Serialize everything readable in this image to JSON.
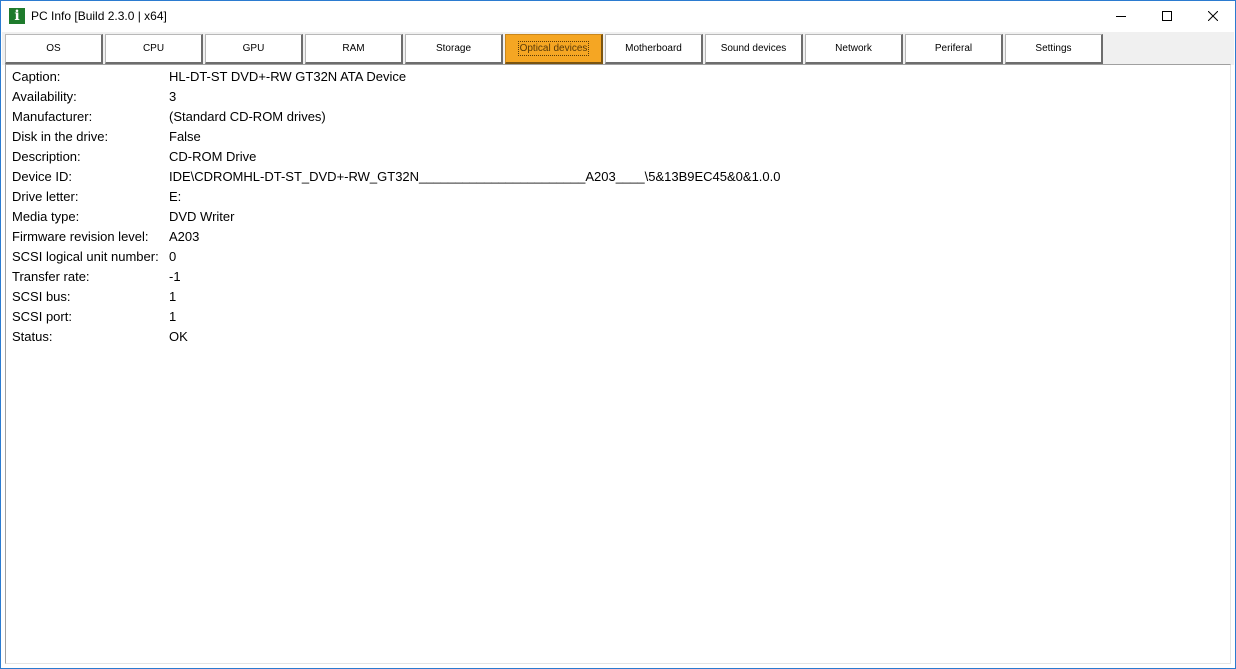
{
  "window": {
    "title": "PC Info [Build 2.3.0 | x64]",
    "icon": "info-icon",
    "icon_glyph": "i"
  },
  "tabs": [
    {
      "label": "OS",
      "active": false
    },
    {
      "label": "CPU",
      "active": false
    },
    {
      "label": "GPU",
      "active": false
    },
    {
      "label": "RAM",
      "active": false
    },
    {
      "label": "Storage",
      "active": false
    },
    {
      "label": "Optical devices",
      "active": true
    },
    {
      "label": "Motherboard",
      "active": false
    },
    {
      "label": "Sound devices",
      "active": false
    },
    {
      "label": "Network",
      "active": false
    },
    {
      "label": "Periferal",
      "active": false
    },
    {
      "label": "Settings",
      "active": false
    }
  ],
  "properties": [
    {
      "label": "Caption:",
      "value": "HL-DT-ST DVD+-RW GT32N ATA Device"
    },
    {
      "label": "Availability:",
      "value": "3"
    },
    {
      "label": "Manufacturer:",
      "value": "(Standard CD-ROM drives)"
    },
    {
      "label": "Disk in the drive:",
      "value": "False"
    },
    {
      "label": "Description:",
      "value": "CD-ROM Drive"
    },
    {
      "label": "Device ID:",
      "value": "IDE\\CDROMHL-DT-ST_DVD+-RW_GT32N_______________________A203____\\5&13B9EC45&0&1.0.0"
    },
    {
      "label": "Drive letter:",
      "value": "E:"
    },
    {
      "label": "Media type:",
      "value": "DVD Writer"
    },
    {
      "label": "Firmware revision level:",
      "value": "A203"
    },
    {
      "label": "SCSI logical unit number:",
      "value": "0"
    },
    {
      "label": "Transfer rate:",
      "value": "-1"
    },
    {
      "label": "SCSI bus:",
      "value": "1"
    },
    {
      "label": "SCSI port:",
      "value": "1"
    },
    {
      "label": "Status:",
      "value": "OK"
    }
  ],
  "colors": {
    "active_tab": "#f5a623",
    "app_icon": "#1e7b2c",
    "window_border": "#2b7bd0"
  }
}
